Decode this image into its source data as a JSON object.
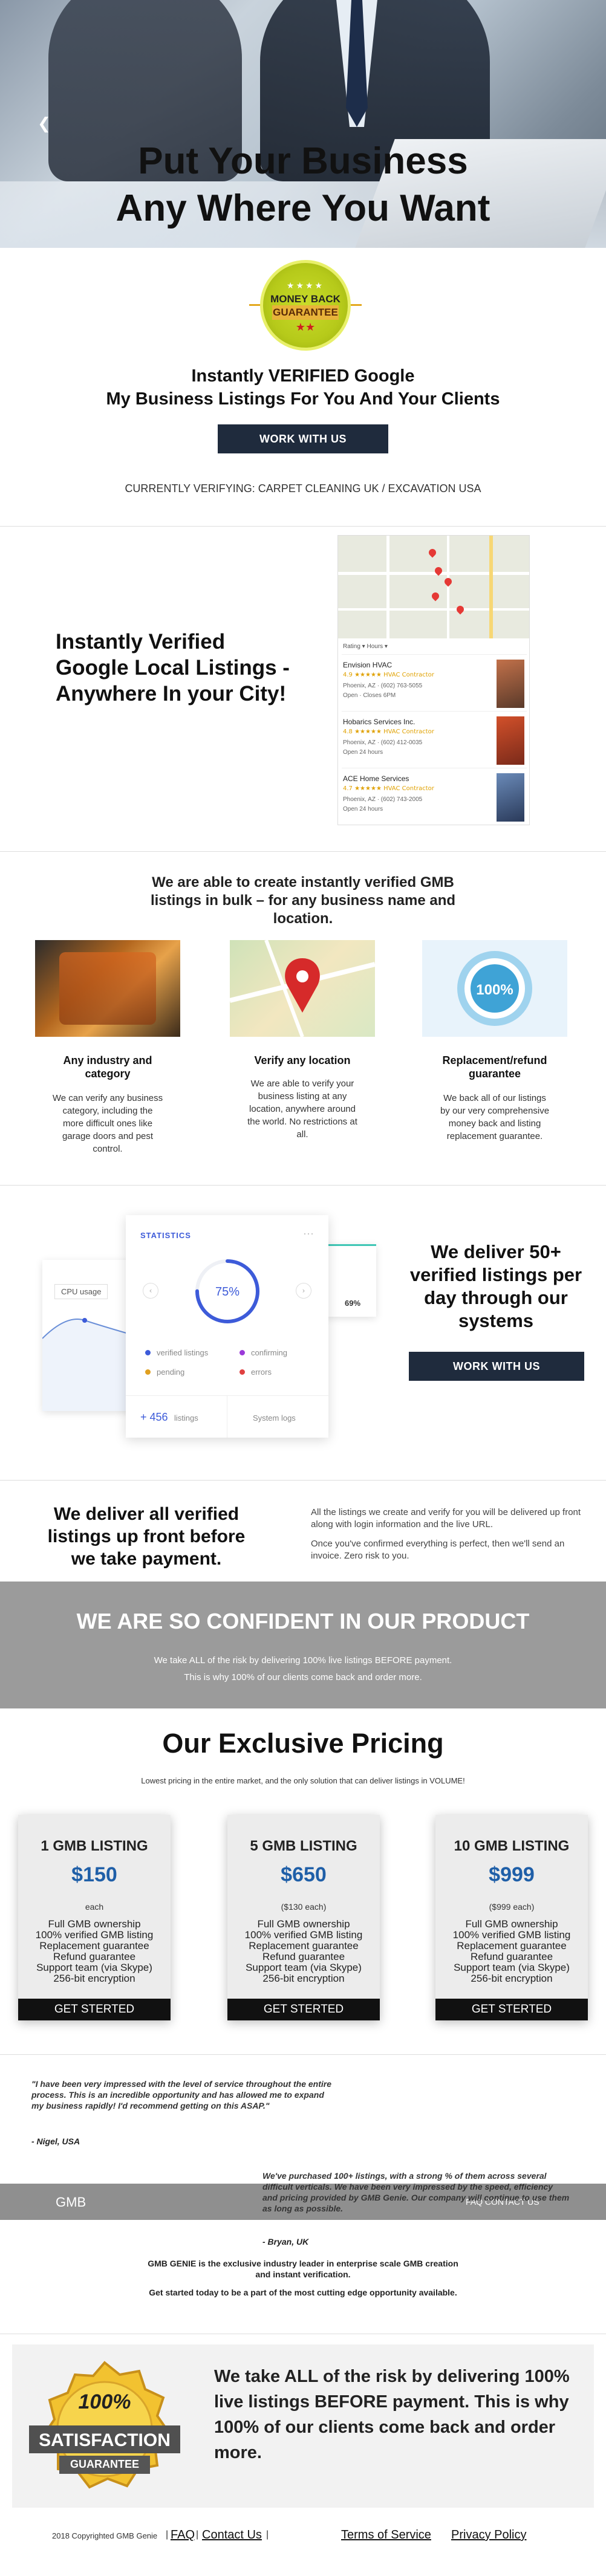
{
  "hero": {
    "line1": "Put Your Business",
    "line2": "Any Where You Want",
    "prev_icon": "chevron-left-icon"
  },
  "badge": {
    "top": "MONEY BACK",
    "ribbon": "GUARANTEE",
    "stars_top": "★★★★",
    "stars_bottom": "★★"
  },
  "intro": {
    "line1": "Instantly VERIFIED Google",
    "line2": "My Business Listings For You And Your Clients",
    "button": "WORK WITH US",
    "verifying": "CURRENTLY VERIFYING: CARPET CLEANING UK / EXCAVATION USA"
  },
  "local": {
    "heading1": "Instantly Verified",
    "heading2": "Google Local Listings -",
    "heading3": "Anywhere In your City!",
    "map_filter": "Rating ▾   Hours ▾",
    "listings": [
      {
        "name": "Envision HVAC",
        "stars": "4.9 ★★★★★ HVAC Contractor",
        "address": "Phoenix, AZ · (602) 763-5055",
        "hours": "Open · Closes 6PM"
      },
      {
        "name": "Hobarics Services Inc.",
        "stars": "4.8 ★★★★★ HVAC Contractor",
        "address": "Phoenix, AZ · (602) 412-0035",
        "hours": "Open 24 hours"
      },
      {
        "name": "ACE Home Services",
        "stars": "4.7 ★★★★★ HVAC Contractor",
        "address": "Phoenix, AZ · (602) 743-2005",
        "hours": "Open 24 hours"
      }
    ]
  },
  "bulk": {
    "line1": "We are able to create instantly verified GMB",
    "line2": "listings in bulk – for any business name and",
    "line3": "location.",
    "features": [
      {
        "title1": "Any industry and",
        "title2": "category",
        "desc": [
          "We can verify any business",
          "category, including the",
          "more difficult ones like",
          "garage doors and pest",
          "control."
        ],
        "icon": "tool-belt-image"
      },
      {
        "title1": "Verify any location",
        "title2": "",
        "desc": [
          "We are able to verify your",
          "business listing at any",
          "location, anywhere around",
          "the world. No restrictions at",
          "all."
        ],
        "icon": "map-pin-image"
      },
      {
        "title1": "Replacement/refund",
        "title2": "guarantee",
        "desc": [
          "We back all of our listings",
          "by our very comprehensive",
          "money back and listing",
          "replacement guarantee."
        ],
        "icon": "guarantee-seal-image"
      }
    ]
  },
  "stats": {
    "title": "STATISTICS",
    "menu": "···",
    "percent": "75%",
    "cpu": "CPU usage",
    "small_percent": "69%",
    "legend": [
      "verified listings",
      "confirming",
      "pending",
      "errors"
    ],
    "legend_colors": [
      "#3d5bd9",
      "#9b3ad9",
      "#e0a020",
      "#e04040"
    ],
    "count": "+ 456",
    "count_label": "listings",
    "system_logs": "System logs",
    "heading1": "We deliver 50+",
    "heading2": "verified listings per",
    "heading3": "day through our",
    "heading4": "systems",
    "button": "WORK WITH US"
  },
  "upfront": {
    "heading1": "We deliver all verified",
    "heading2": "listings up front before",
    "heading3": "we take payment.",
    "p1a": "All the listings we create and verify for you will be delivered up front",
    "p1b": "along with login information and the live URL.",
    "p2a": "Once you've confirmed everything is perfect, then we'll send an",
    "p2b": "invoice. Zero risk to you."
  },
  "confident": {
    "title": "WE ARE SO CONFIDENT IN OUR PRODUCT",
    "line1": "We take ALL of the risk by delivering 100% live listings BEFORE payment.",
    "line2": "This is why 100% of our clients come back and order more."
  },
  "pricing": {
    "title": "Our Exclusive Pricing",
    "subtitle": "Lowest pricing in the entire market, and the only solution that can deliver listings in VOLUME!",
    "plans": [
      {
        "name": "1 GMB LISTING",
        "price": "$150",
        "each": "each",
        "button": "GET STERTED"
      },
      {
        "name": "5 GMB LISTING",
        "price": "$650",
        "each": "($130 each)",
        "button": "GET STERTED"
      },
      {
        "name": "10 GMB LISTING",
        "price": "$999",
        "each": "($999 each)",
        "button": "GET STERTED"
      }
    ],
    "features": [
      "Full GMB ownership",
      "100% verified GMB listing",
      "Replacement guarantee",
      "Refund guarantee",
      "Support team (via Skype)",
      "256-bit encryption"
    ]
  },
  "testimonials": {
    "q1": [
      "\"I have been very impressed with the level of service throughout the entire",
      "process. This is an incredible opportunity and has allowed me to expand",
      "my business rapidly! I'd recommend getting on this ASAP.\""
    ],
    "n1": "- Nigel, USA",
    "q2": [
      "We've purchased 100+ listings, with a strong % of them across several",
      "difficult verticals. We have been very impressed by the speed, efficiency",
      "and pricing provided by GMB Genie. Our company will continue to use them",
      "as long as possible."
    ],
    "n2": "- Bryan, UK",
    "bar_label": "GMB",
    "bar_right": "FAQ   CONTACT US"
  },
  "genie": {
    "line1": "GMB GENIE is the exclusive industry leader in enterprise scale GMB creation",
    "line2": "and instant verification.",
    "line3": "Get started today to be a part of the most cutting edge opportunity available."
  },
  "satisfaction": {
    "seal_top": "100%",
    "seal_mid": "SATISFACTION",
    "seal_bottom": "GUARANTEE",
    "text1": "We take ALL of the risk by delivering 100%",
    "text2": "live listings BEFORE payment. This is why",
    "text3": "100% of our clients come back and order",
    "text4": "more."
  },
  "footer": {
    "copyright": "2018 Copyrighted GMB Genie",
    "sep1": "|",
    "faq": "FAQ",
    "sep2": "|",
    "contact": "Contact Us",
    "sep3": "|",
    "terms": "Terms of Service",
    "privacy": "Privacy Policy"
  },
  "colors": {
    "navy": "#1f2b3d",
    "price_blue": "#1f5fa8",
    "banner_gray": "#9b9b9b",
    "badge_green": "#c9dc2a"
  }
}
